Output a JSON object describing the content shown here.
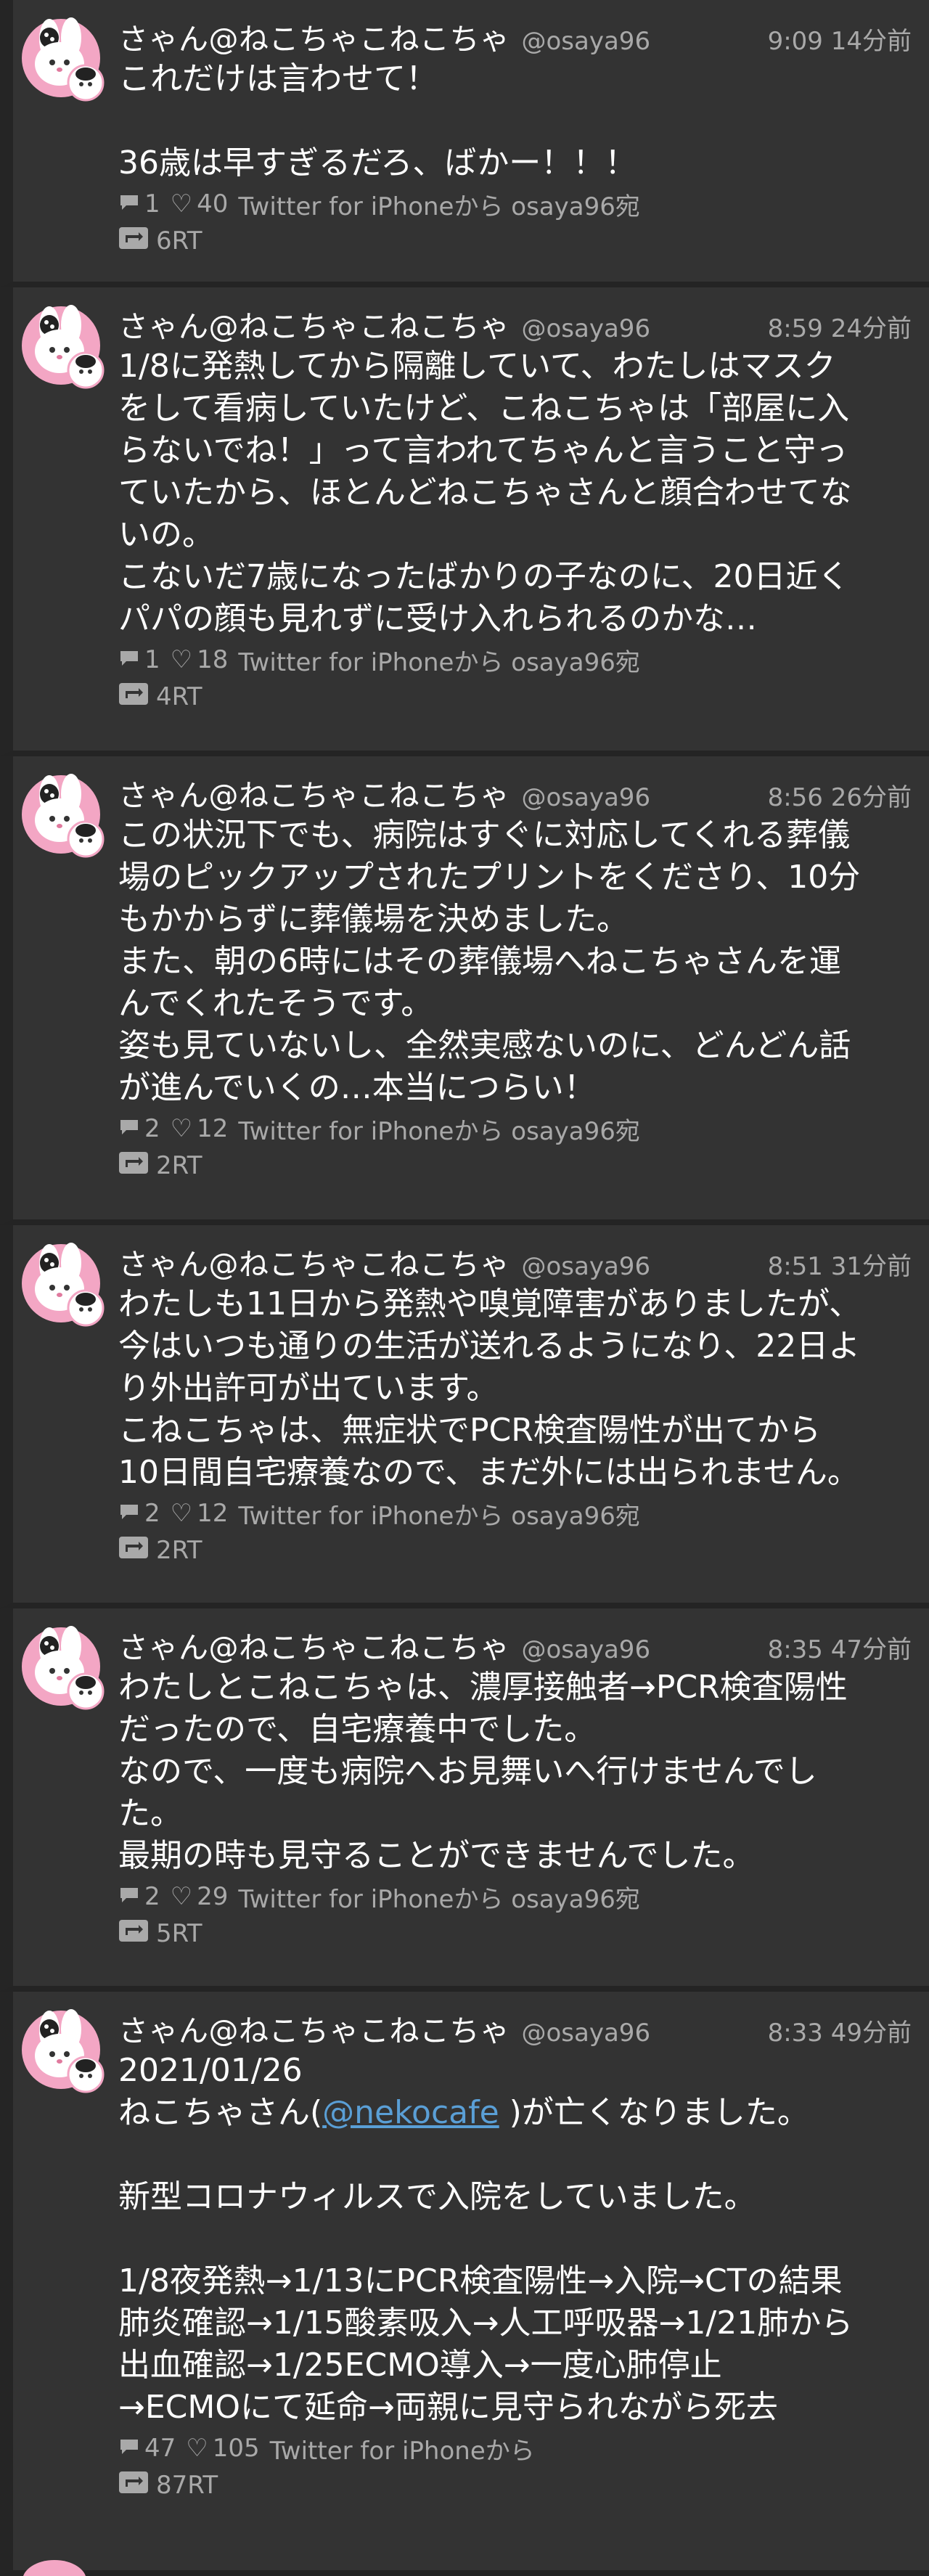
{
  "colors": {
    "background": "#2b2b2b",
    "tweet_background": "#333333",
    "text": "#ffffff",
    "muted": "#a9a9a9",
    "link": "#5a9fd6",
    "avatar_pink": "#f3a6c4"
  },
  "icons": {
    "reply": "speech-bubble-icon",
    "like": "heart-icon",
    "retweet": "retweet-icon"
  },
  "tweets": [
    {
      "name": "さゃん@ねこちゃこねこちゃ",
      "handle": "@osaya96",
      "time": "9:09 14分前",
      "lines": [
        "これだけは言わせて！",
        "",
        "36歳は早すぎるだろ、ばかー！！！"
      ],
      "replies": "1",
      "likes": "40",
      "source": "Twitter for iPhoneから osaya96宛",
      "retweets": "6RT"
    },
    {
      "name": "さゃん@ねこちゃこねこちゃ",
      "handle": "@osaya96",
      "time": "8:59 24分前",
      "lines": [
        "1/8に発熱してから隔離していて、わたしはマスク",
        "をして看病していたけど、こねこちゃは「部屋に入",
        "らないでね！」って言われてちゃんと言うこと守っ",
        "ていたから、ほとんどねこちゃさんと顔合わせてな",
        "いの。",
        "こないだ7歳になったばかりの子なのに、20日近く",
        "パパの顔も見れずに受け入れられるのかな…"
      ],
      "replies": "1",
      "likes": "18",
      "source": "Twitter for iPhoneから osaya96宛",
      "retweets": "4RT"
    },
    {
      "name": "さゃん@ねこちゃこねこちゃ",
      "handle": "@osaya96",
      "time": "8:56 26分前",
      "lines": [
        "この状況下でも、病院はすぐに対応してくれる葬儀",
        "場のピックアップされたプリントをくださり、10分",
        "もかからずに葬儀場を決めました。",
        "また、朝の6時にはその葬儀場へねこちゃさんを運",
        "んでくれたそうです。",
        "姿も見ていないし、全然実感ないのに、どんどん話",
        "が進んでいくの…本当につらい！"
      ],
      "replies": "2",
      "likes": "12",
      "source": "Twitter for iPhoneから osaya96宛",
      "retweets": "2RT"
    },
    {
      "name": "さゃん@ねこちゃこねこちゃ",
      "handle": "@osaya96",
      "time": "8:51 31分前",
      "lines": [
        "わたしも11日から発熱や嗅覚障害がありましたが、",
        "今はいつも通りの生活が送れるようになり、22日よ",
        "り外出許可が出ています。",
        "こねこちゃは、無症状でPCR検査陽性が出てから",
        "10日間自宅療養なので、まだ外には出られません。"
      ],
      "replies": "2",
      "likes": "12",
      "source": "Twitter for iPhoneから osaya96宛",
      "retweets": "2RT"
    },
    {
      "name": "さゃん@ねこちゃこねこちゃ",
      "handle": "@osaya96",
      "time": "8:35 47分前",
      "lines": [
        "わたしとこねこちゃは、濃厚接触者→PCR検査陽性",
        "だったので、自宅療養中でした。",
        "なので、一度も病院へお見舞いへ行けませんでし",
        "た。",
        "最期の時も見守ることができませんでした。"
      ],
      "replies": "2",
      "likes": "29",
      "source": "Twitter for iPhoneから osaya96宛",
      "retweets": "5RT"
    },
    {
      "name": "さゃん@ねこちゃこねこちゃ",
      "handle": "@osaya96",
      "time": "8:33 49分前",
      "line0": "2021/01/26",
      "line1_before": "ねこちゃさん(",
      "line1_mention": "@nekocafe",
      "line1_after": " )が亡くなりました。",
      "lines_rest": [
        "",
        "新型コロナウィルスで入院をしていました。",
        "",
        "1/8夜発熱→1/13にPCR検査陽性→入院→CTの結果",
        "肺炎確認→1/15酸素吸入→人工呼吸器→1/21肺から",
        "出血確認→1/25ECMO導入→一度心肺停止",
        "→ECMOにて延命→両親に見守られながら死去"
      ],
      "replies": "47",
      "likes": "105",
      "source": "Twitter for iPhoneから",
      "retweets": "87RT"
    }
  ]
}
